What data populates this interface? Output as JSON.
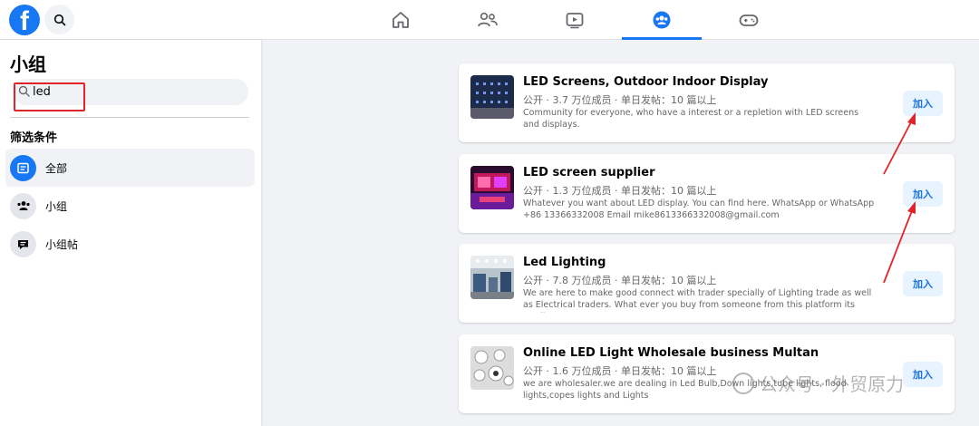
{
  "brand": {
    "logo_letter": "f",
    "color": "#1877f2"
  },
  "topbar": {
    "nav": [
      {
        "icon": "home-icon",
        "active": false
      },
      {
        "icon": "friends-icon",
        "active": false
      },
      {
        "icon": "watch-icon",
        "active": false
      },
      {
        "icon": "groups-icon",
        "active": true
      },
      {
        "icon": "gaming-icon",
        "active": false
      }
    ]
  },
  "sidebar": {
    "title": "小组",
    "search": {
      "value": "led"
    },
    "filter_heading": "筛选条件",
    "items": [
      {
        "label": "全部",
        "icon": "all-icon",
        "active": true
      },
      {
        "label": "小组",
        "icon": "groups-icon",
        "active": false
      },
      {
        "label": "小组帖",
        "icon": "group-posts-icon",
        "active": false
      }
    ]
  },
  "results": [
    {
      "title": "LED Screens, Outdoor Indoor Display",
      "meta": "公开 · 3.7 万位成员 · 单日发帖：10 篇以上",
      "description": "Community for everyone, who have a interest or a repletion with LED screens and displays.",
      "join_label": "加入"
    },
    {
      "title": "LED screen supplier",
      "meta": "公开 · 1.3 万位成员 · 单日发帖：10 篇以上",
      "description": "Whatever you want about LED display. You can find here. WhatsApp or WhatsApp +86 13366332008 Email mike8613366332008@gmail.com",
      "join_label": "加入"
    },
    {
      "title": "Led Lighting",
      "meta": "公开 · 7.8 万位成员 · 单日发帖：10 篇以上",
      "description": "We are here to make good connect with trader specially of Lighting trade as well as Electrical traders. What ever you buy from someone from this platform its totally on yo...",
      "join_label": "加入"
    },
    {
      "title": "Online LED Light Wholesale business Multan",
      "meta": "公开 · 1.6 万位成员 · 单日发帖：10 篇以上",
      "description": "we are wholesaler.we are dealing in Led Bulb,Down lights,tube lights, flood lights,copes lights and Lights",
      "join_label": "加入"
    }
  ],
  "watermark": {
    "text": "公众号 · 外贸原力"
  },
  "colors": {
    "accent": "#1877f2",
    "annotation": "#e0242a",
    "join_bg": "#e7f3ff"
  }
}
